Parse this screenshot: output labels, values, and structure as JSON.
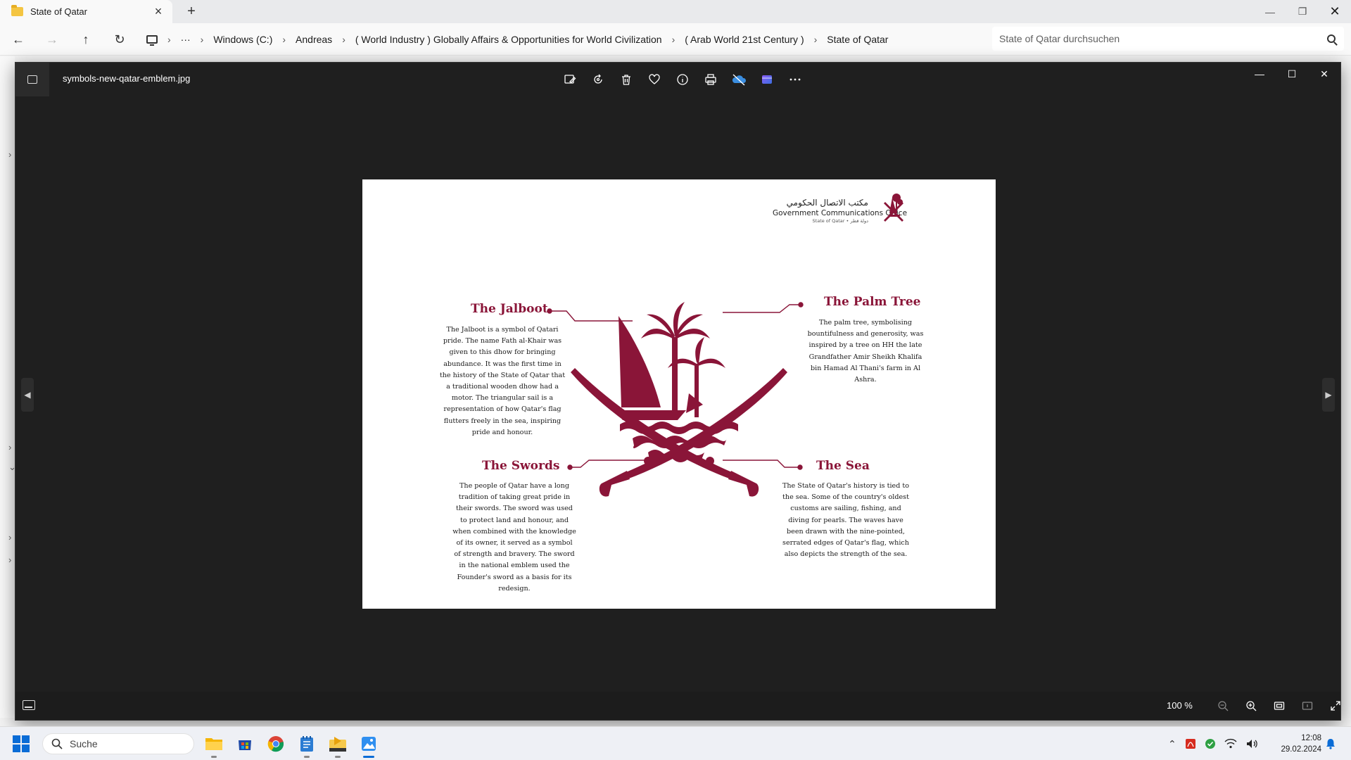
{
  "explorer": {
    "tab_title": "State of Qatar",
    "breadcrumb": [
      "Windows (C:)",
      "Andreas",
      "( World Industry ) Globally Affairs & Opportunities for World Civilization",
      "( Arab World 21st Century )",
      "State of Qatar"
    ],
    "search_placeholder": "State of Qatar durchsuchen"
  },
  "viewer": {
    "filename": "symbols-new-qatar-emblem.jpg",
    "zoom": "100 %"
  },
  "image": {
    "logo": {
      "arabic": "مكتب الاتصال الحكومي",
      "english": "Government Communications Office",
      "sub": "State of Qatar • دولة قطر"
    },
    "sections": {
      "jalboot": {
        "title": "The Jalboot",
        "body": "The Jalboot is a symbol of Qatari pride. The name Fath al-Khair was given to this dhow for bringing abundance. It was the first time in the history of the State of Qatar that a traditional wooden dhow had a motor. The triangular sail is a representation of how Qatar's flag flutters freely in the sea, inspiring pride and honour."
      },
      "palm": {
        "title": "The Palm Tree",
        "body": "The palm tree, symbolising bountifulness and generosity, was inspired by a tree on HH the late Grandfather Amir Sheikh Khalifa bin Hamad Al Thani's farm in Al Ashra."
      },
      "swords": {
        "title": "The Swords",
        "body": "The people of Qatar have a long tradition of taking great pride in their swords. The sword was used to protect land and honour, and when combined with the knowledge of its owner, it served as a symbol of strength and bravery. The sword in the national emblem used the Founder's sword as a basis for its redesign."
      },
      "sea": {
        "title": "The Sea",
        "body": "The State of Qatar's history is tied to the sea. Some of the country's oldest customs are sailing, fishing, and diving for pearls. The waves have been drawn with the nine-pointed, serrated edges of Qatar's flag, which also depicts the strength of the sea."
      }
    }
  },
  "taskbar": {
    "search_label": "Suche",
    "time": "12:08",
    "date": "29.02.2024"
  },
  "colors": {
    "maroon": "#8a1538",
    "viewer_bg": "#1f1f1f",
    "accent": "#0a6cd6"
  }
}
